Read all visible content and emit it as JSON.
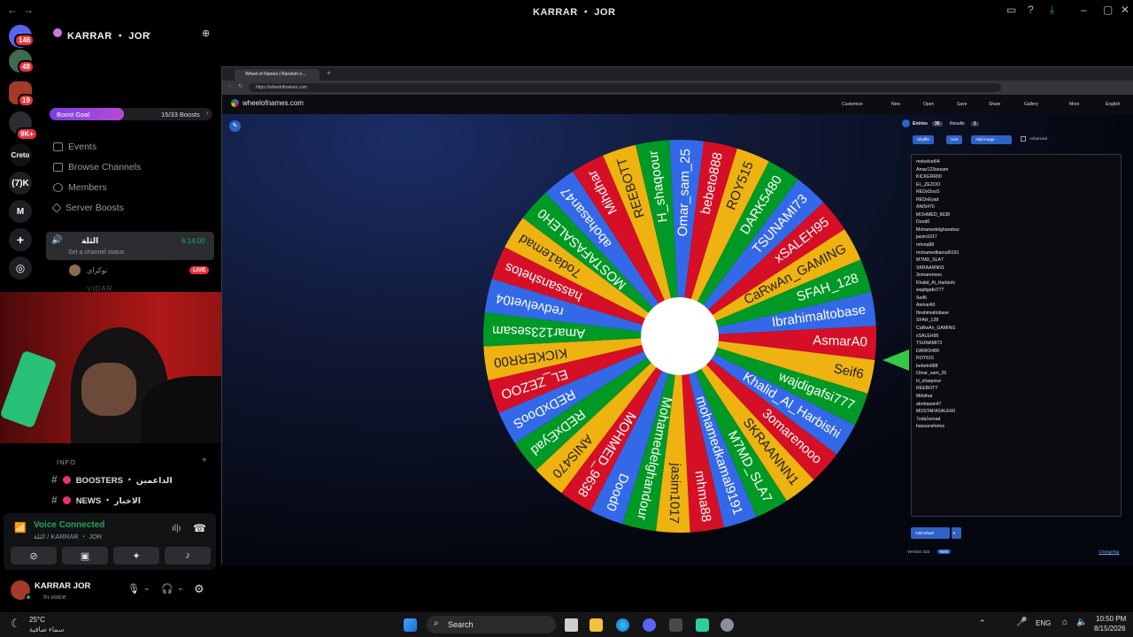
{
  "window": {
    "title": "KARRAR ・ JOR"
  },
  "rail": {
    "badges": [
      "146",
      "48",
      "19",
      "9K+"
    ],
    "servers": [
      "Creto",
      "(7)K",
      "M"
    ]
  },
  "sidebar": {
    "guild_name": "KARRAR ・ JOR",
    "boost_goal_label": "Boost Goal",
    "boost_goal_progress": "15/33 Boosts",
    "boost_goal_fraction": 0.4545,
    "menu": [
      "Events",
      "Browse Channels",
      "Members",
      "Server Boosts"
    ],
    "voice_channel": {
      "name": "الثلة",
      "status_prompt": "Set a channel status",
      "timer": "6:14:00"
    },
    "members": [
      {
        "name": "نوكراي",
        "badge": "LIVE"
      },
      {
        "name": "VIDAR"
      }
    ],
    "category": "INFO",
    "channels": [
      {
        "label": "BOOSTERS ・ الداعمين"
      },
      {
        "label": "NEWS ・ الاخبار"
      }
    ]
  },
  "voice_panel": {
    "status": "Voice Connected",
    "location": "الثلة / KARRAR ・ JOR"
  },
  "user": {
    "name": "KARRAR JOR",
    "status": "In voice"
  },
  "browser": {
    "tab_title": "Wheel of Names | Random n...",
    "url": "https://wheelofnames.com",
    "site_name": "wheelofnames.com",
    "nav": [
      "Customize",
      "New",
      "Open",
      "Save",
      "Share",
      "Gallery",
      "More",
      "English"
    ],
    "panel_tabs": {
      "entries": "Entries",
      "entries_count": "36",
      "results": "Results",
      "results_count": "1"
    },
    "buttons": {
      "shuffle": "Shuffle",
      "sort": "Sort",
      "add_image": "Add image",
      "advanced": "Advanced",
      "add_wheel": "Add wheel"
    },
    "version": "Version 422",
    "new_badge": "New",
    "changelog": "Changelog",
    "entries": [
      "redvelvet04",
      "Amar123sesam",
      "KICKERR00",
      "EL_ZEZOO",
      "REDxDooS",
      "REDxEyad",
      "ANIS470",
      "MOHMED_9638",
      "Dood0",
      "Mohamedelghandour",
      "jasim1017",
      "mhma88",
      "mohamedkamal9191",
      "M7MD_SLA7",
      "SKRAANNN1",
      "3omarenooo",
      "Khalid_Al_Harbishi",
      "wajdigafsi777",
      "Seif6",
      "AsmarA0",
      "Ibrahimaltobase",
      "SFAH_128",
      "CaRwAn_GAMING",
      "xSALEH95",
      "TSUNAMI73",
      "DARK5480",
      "ROY515",
      "bebeto888",
      "Omar_sam_25",
      "H_shaqoour",
      "REEBOTT",
      "Mihdhar",
      "abohasan47",
      "MOSTAFASALEH0",
      "7oda1emad",
      "hassanshetos"
    ]
  },
  "wheel": {
    "colors": [
      "#3369e8",
      "#d50f25",
      "#eeb211",
      "#009925"
    ],
    "labels": [
      "Ibrahimaltobase",
      "AsmarA0",
      "Seif6",
      "wajdigafsi777",
      "Khalid_Al_Harbishi",
      "3omarenooo",
      "SKRAANNN1",
      "M7MD_SLA7",
      "mohamedkamal9191",
      "mhma88",
      "jasim1017",
      "Mohamedelghandour",
      "Dood0",
      "MOHMED_9638",
      "ANIS470",
      "REDxEyad",
      "REDxDooS",
      "EL_ZEZOO",
      "KICKERR00",
      "Amar123sesam",
      "redvelvet04",
      "hassanshetos",
      "7oda1emad",
      "MOSTAFASALEH0",
      "abohasan47",
      "Mihdhar",
      "REEBOTT",
      "H_shaqoour",
      "Omar_sam_25",
      "bebeto888",
      "ROY515",
      "DARK5480",
      "TSUNAMI73",
      "xSALEH95",
      "CaRwAn_GAMING",
      "SFAH_128"
    ]
  },
  "taskbar": {
    "weather_temp": "25°C",
    "weather_desc": "سماء صافية",
    "search": "Search",
    "lang": "ENG",
    "time": "10:50 PM",
    "date": "8/15/2026"
  },
  "colors": {
    "accent": "#5865f2",
    "voice_green": "#23a55a",
    "live_red": "#e8333b",
    "boost_purple": "#9b4ae0"
  }
}
